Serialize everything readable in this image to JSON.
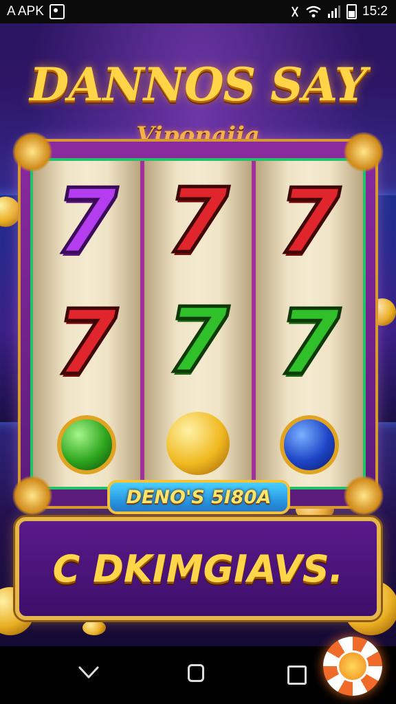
{
  "status_bar": {
    "left_text": "A APK",
    "time": "15:2",
    "icons": [
      "notification-icon",
      "vibrate-icon",
      "wifi-icon",
      "signal-icon",
      "battery-icon"
    ]
  },
  "game": {
    "title": "DANNOS SAY",
    "subtitle": "Viponaiia",
    "reels": [
      [
        "purple-seven",
        "red-seven",
        "green-orb"
      ],
      [
        "red-seven",
        "green-seven",
        "gold-coin"
      ],
      [
        "red-seven",
        "green-seven",
        "blue-orb"
      ]
    ],
    "seven_glyph": "7",
    "banner_text": "DENO'S 5I80A",
    "panel_text": "C DKIMGIAVS."
  },
  "nav_bar": {
    "icons": [
      "back-icon",
      "home-icon",
      "recents-icon"
    ]
  },
  "colors": {
    "title_gold": "#ffd447",
    "frame_purple": "#8b2a9e",
    "banner_blue": "#1775cf"
  }
}
